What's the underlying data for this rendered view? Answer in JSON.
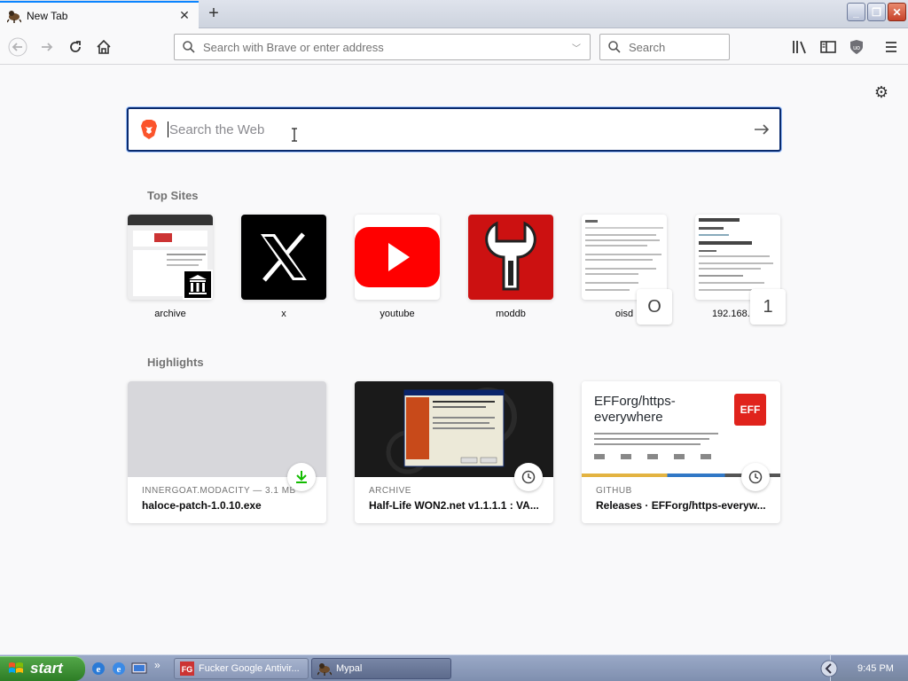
{
  "browser": {
    "tab": {
      "title": "New Tab"
    },
    "address_placeholder": "Search with Brave or enter address",
    "search_placeholder": "Search"
  },
  "newtab": {
    "web_search_placeholder": "Search the Web",
    "top_sites_title": "Top Sites",
    "top_sites": [
      {
        "label": "archive"
      },
      {
        "label": "x"
      },
      {
        "label": "youtube"
      },
      {
        "label": "moddb"
      },
      {
        "label": "oisd",
        "badge": "O"
      },
      {
        "label": "192.168.1.1",
        "badge": "1"
      }
    ],
    "highlights_title": "Highlights",
    "highlights": [
      {
        "context": "INNERGOAT.MODACITY — 3.1 MB",
        "title": "haloce-patch-1.0.10.exe",
        "icon": "download-icon"
      },
      {
        "context": "ARCHIVE",
        "title": "Half-Life WON2.net v1.1.1.1 : VA...",
        "icon": "clock-icon"
      },
      {
        "context": "GITHUB",
        "title": "Releases · EFForg/https-everyw...",
        "icon": "clock-icon",
        "preview_title": "EFForg/https-everywhere",
        "preview_logo": "EFF"
      }
    ]
  },
  "taskbar": {
    "start_label": "start",
    "tasks": [
      {
        "label": "Fucker Google Antivir..."
      },
      {
        "label": "Mypal"
      }
    ],
    "clock": "9:45 PM"
  },
  "colors": {
    "accent": "#0a84ff",
    "youtube_red": "#ff0000",
    "moddb_red": "#cc1111",
    "eff_red": "#e0231c",
    "download_green": "#12bc00"
  }
}
